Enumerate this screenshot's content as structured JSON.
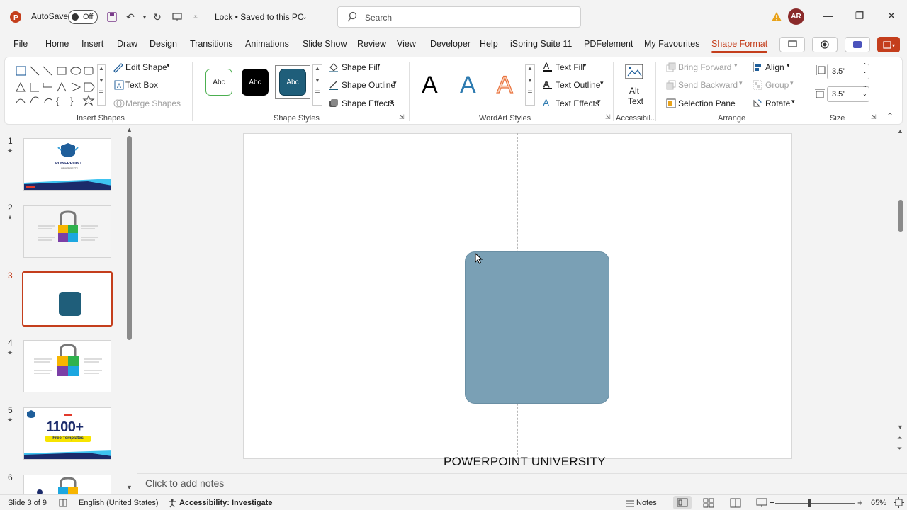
{
  "titlebar": {
    "autosave_label": "AutoSave",
    "autosave_state": "Off",
    "doc_title": "Lock • Saved to this PC",
    "search_placeholder": "Search",
    "user_initials": "AR"
  },
  "tabs": [
    {
      "label": "File"
    },
    {
      "label": "Home"
    },
    {
      "label": "Insert"
    },
    {
      "label": "Draw"
    },
    {
      "label": "Design"
    },
    {
      "label": "Transitions"
    },
    {
      "label": "Animations"
    },
    {
      "label": "Slide Show"
    },
    {
      "label": "Review"
    },
    {
      "label": "View"
    },
    {
      "label": "Developer"
    },
    {
      "label": "Help"
    },
    {
      "label": "iSpring Suite 11"
    },
    {
      "label": "PDFelement"
    },
    {
      "label": "My Favourites"
    },
    {
      "label": "Shape Format"
    }
  ],
  "ribbon": {
    "insert_shapes": {
      "edit_shape": "Edit Shape",
      "text_box": "Text Box",
      "merge_shapes": "Merge Shapes",
      "label": "Insert Shapes"
    },
    "shape_styles": {
      "swatch_text": "Abc",
      "shape_fill": "Shape Fill",
      "shape_outline": "Shape Outline",
      "shape_effects": "Shape Effects",
      "label": "Shape Styles"
    },
    "wordart": {
      "letter": "A",
      "text_fill": "Text Fill",
      "text_outline": "Text Outline",
      "text_effects": "Text Effects",
      "label": "WordArt Styles"
    },
    "accessibility": {
      "alt_text_line1": "Alt",
      "alt_text_line2": "Text",
      "label": "Accessibil..."
    },
    "arrange": {
      "bring_forward": "Bring Forward",
      "send_backward": "Send Backward",
      "selection_pane": "Selection Pane",
      "align": "Align",
      "group": "Group",
      "rotate": "Rotate",
      "label": "Arrange"
    },
    "size": {
      "height": "3.5\"",
      "width": "3.5\"",
      "label": "Size"
    }
  },
  "slides": [
    {
      "number": "1",
      "starred": "★",
      "thumb_title": "POWERPOINT",
      "thumb_sub": "UNIVERSITY"
    },
    {
      "number": "2",
      "starred": "★"
    },
    {
      "number": "3",
      "starred": ""
    },
    {
      "number": "4",
      "starred": "★"
    },
    {
      "number": "5",
      "starred": "★",
      "thumb_big": "1100+",
      "thumb_banner": "Free Templates"
    },
    {
      "number": "6",
      "starred": ""
    }
  ],
  "slide": {
    "footer_text": "POWERPOINT UNIVERSITY",
    "shape_color": "#7aa0b5"
  },
  "notes": {
    "placeholder": "Click to add notes"
  },
  "status": {
    "slide_count": "Slide 3 of 9",
    "language": "English (United States)",
    "accessibility": "Accessibility: Investigate",
    "notes_button": "Notes",
    "zoom": "65%"
  },
  "colors": {
    "accent": "#c43e1c",
    "selected_style": "#1f5e7a"
  }
}
